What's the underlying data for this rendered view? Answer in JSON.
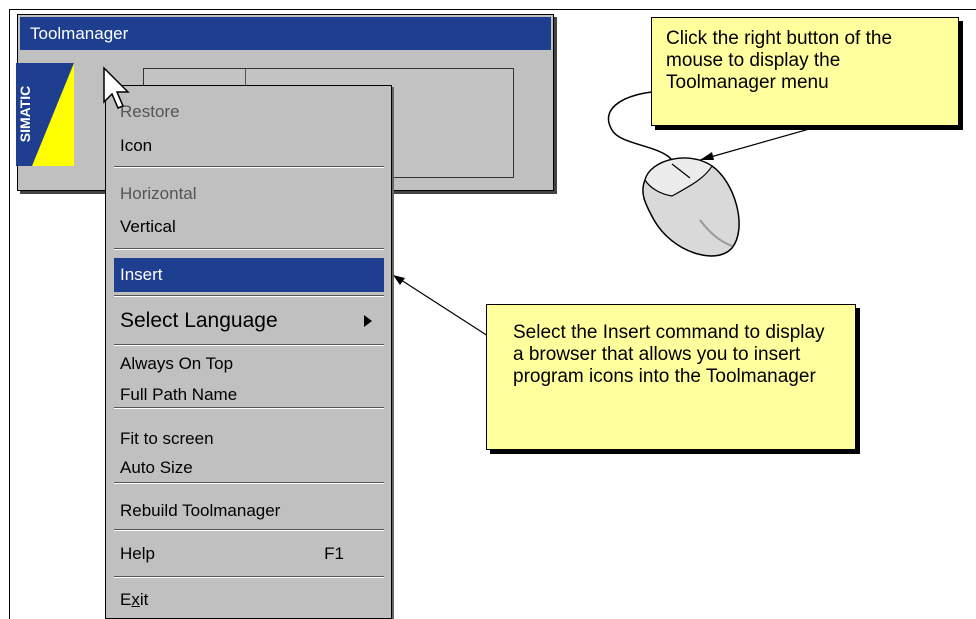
{
  "window": {
    "title": "Toolmanager",
    "logo_text": "SIMATIC"
  },
  "menu": {
    "items": [
      {
        "label": "Restore",
        "disabled": true
      },
      {
        "label": "Icon",
        "disabled": false
      },
      {
        "label": "Horizontal",
        "disabled": true
      },
      {
        "label": "Vertical",
        "disabled": false
      },
      {
        "label": "Insert",
        "selected": true
      },
      {
        "label": "Select Language",
        "submenu": true
      },
      {
        "label": "Always On Top"
      },
      {
        "label": "Full Path Name"
      },
      {
        "label": "Fit to screen"
      },
      {
        "label": "Auto Size"
      },
      {
        "label": "Rebuild Toolmanager"
      },
      {
        "label": "Help",
        "shortcut": "F1"
      },
      {
        "label": "Exit",
        "mnemonic": "x"
      }
    ],
    "exit_pre": "E",
    "exit_mnemonic": "x",
    "exit_post": "it"
  },
  "callouts": {
    "mouse": "Click the right button of the mouse to display the Toolmanager menu",
    "insert": "Select the Insert command to display a browser that allows you to insert program icons into the Toolmanager"
  },
  "colors": {
    "title_bar": "#1e3f8f",
    "selected": "#1e3f8f",
    "callout_bg": "#ffff9e",
    "window_bg": "#c0c0c0"
  }
}
